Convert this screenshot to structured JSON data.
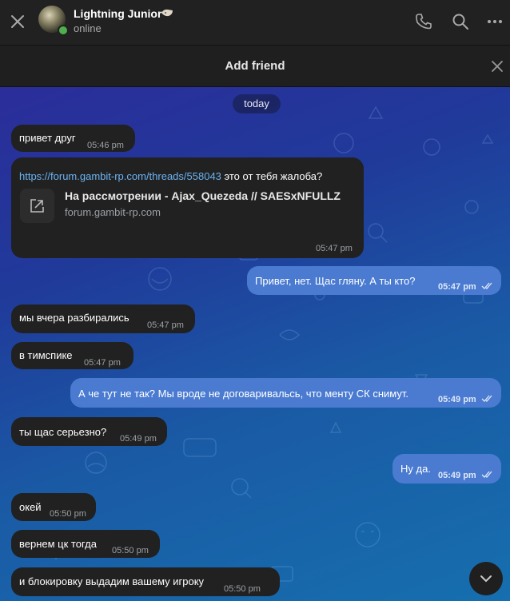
{
  "header": {
    "name": "Lightning Junior",
    "status": "online"
  },
  "banner": {
    "label": "Add friend"
  },
  "chat": {
    "date_divider": "today",
    "messages": [
      {
        "dir": "in",
        "text": "привет друг",
        "time": "05:46 pm"
      },
      {
        "dir": "in",
        "link": "https://forum.gambit-rp.com/threads/558043",
        "text": "это от тебя жалоба?",
        "preview_title": "На рассмотрении - Ajax_Quezeda // SAESxNFULLZ",
        "preview_site": "forum.gambit-rp.com",
        "time": "05:47 pm"
      },
      {
        "dir": "out",
        "text": "Привет, нет. Щас гляну. А ты кто?",
        "time": "05:47 pm"
      },
      {
        "dir": "in",
        "text": "мы вчера разбирались",
        "time": "05:47 pm"
      },
      {
        "dir": "in",
        "text": "в тимспике",
        "time": "05:47 pm"
      },
      {
        "dir": "out",
        "text": "А че тут не так? Мы вроде не договаривальсь, что менту СК снимут.",
        "time": "05:49 pm"
      },
      {
        "dir": "in",
        "text": "ты щас серьезно?",
        "time": "05:49 pm"
      },
      {
        "dir": "out",
        "text": "Ну да.",
        "time": "05:49 pm"
      },
      {
        "dir": "in",
        "text": "окей",
        "time": "05:50 pm"
      },
      {
        "dir": "in",
        "text": "вернем цк тогда",
        "time": "05:50 pm"
      },
      {
        "dir": "in",
        "text": "и блокировку выдадим вашему игроку",
        "time": "05:50 pm"
      }
    ]
  },
  "colors": {
    "incoming_bubble": "#212121",
    "outgoing_bubble": "#4a7bd1",
    "link": "#6ab3f3",
    "online": "#4fae4e"
  },
  "icons": [
    "close-icon",
    "emoji-badge-icon",
    "phone-icon",
    "search-icon",
    "more-icon",
    "external-link-icon",
    "double-check-icon",
    "chevron-down-icon"
  ]
}
